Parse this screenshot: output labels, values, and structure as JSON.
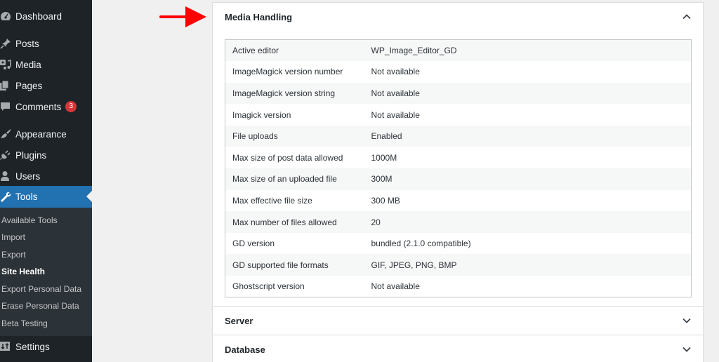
{
  "sidebar": {
    "items": [
      {
        "label": "Dashboard",
        "icon": "dashboard-icon"
      },
      {
        "label": "Posts",
        "icon": "pin-icon"
      },
      {
        "label": "Media",
        "icon": "media-icon"
      },
      {
        "label": "Pages",
        "icon": "pages-icon"
      },
      {
        "label": "Comments",
        "icon": "comment-icon",
        "badge": "3"
      },
      {
        "label": "Appearance",
        "icon": "paintbrush-icon"
      },
      {
        "label": "Plugins",
        "icon": "plugin-icon"
      },
      {
        "label": "Users",
        "icon": "user-icon"
      },
      {
        "label": "Tools",
        "icon": "wrench-icon",
        "active": true
      },
      {
        "label": "Settings",
        "icon": "settings-icon"
      }
    ],
    "submenu": [
      {
        "label": "Available Tools"
      },
      {
        "label": "Import"
      },
      {
        "label": "Export"
      },
      {
        "label": "Site Health",
        "current": true
      },
      {
        "label": "Export Personal Data"
      },
      {
        "label": "Erase Personal Data"
      },
      {
        "label": "Beta Testing"
      }
    ]
  },
  "colors": {
    "sidebar_bg": "#1d2327",
    "submenu_bg": "#2c3338",
    "accent": "#2271b1",
    "badge": "#d63638",
    "annotation_arrow": "#ff0000"
  },
  "sections": [
    {
      "title": "Media Handling",
      "expanded": true
    },
    {
      "title": "Server",
      "expanded": false
    },
    {
      "title": "Database",
      "expanded": false
    }
  ],
  "media_handling": {
    "rows": [
      {
        "key": "Active editor",
        "value": "WP_Image_Editor_GD"
      },
      {
        "key": "ImageMagick version number",
        "value": "Not available"
      },
      {
        "key": "ImageMagick version string",
        "value": "Not available"
      },
      {
        "key": "Imagick version",
        "value": "Not available"
      },
      {
        "key": "File uploads",
        "value": "Enabled"
      },
      {
        "key": "Max size of post data allowed",
        "value": "1000M"
      },
      {
        "key": "Max size of an uploaded file",
        "value": "300M"
      },
      {
        "key": "Max effective file size",
        "value": "300 MB"
      },
      {
        "key": "Max number of files allowed",
        "value": "20"
      },
      {
        "key": "GD version",
        "value": "bundled (2.1.0 compatible)"
      },
      {
        "key": "GD supported file formats",
        "value": "GIF, JPEG, PNG, BMP"
      },
      {
        "key": "Ghostscript version",
        "value": "Not available"
      }
    ]
  }
}
